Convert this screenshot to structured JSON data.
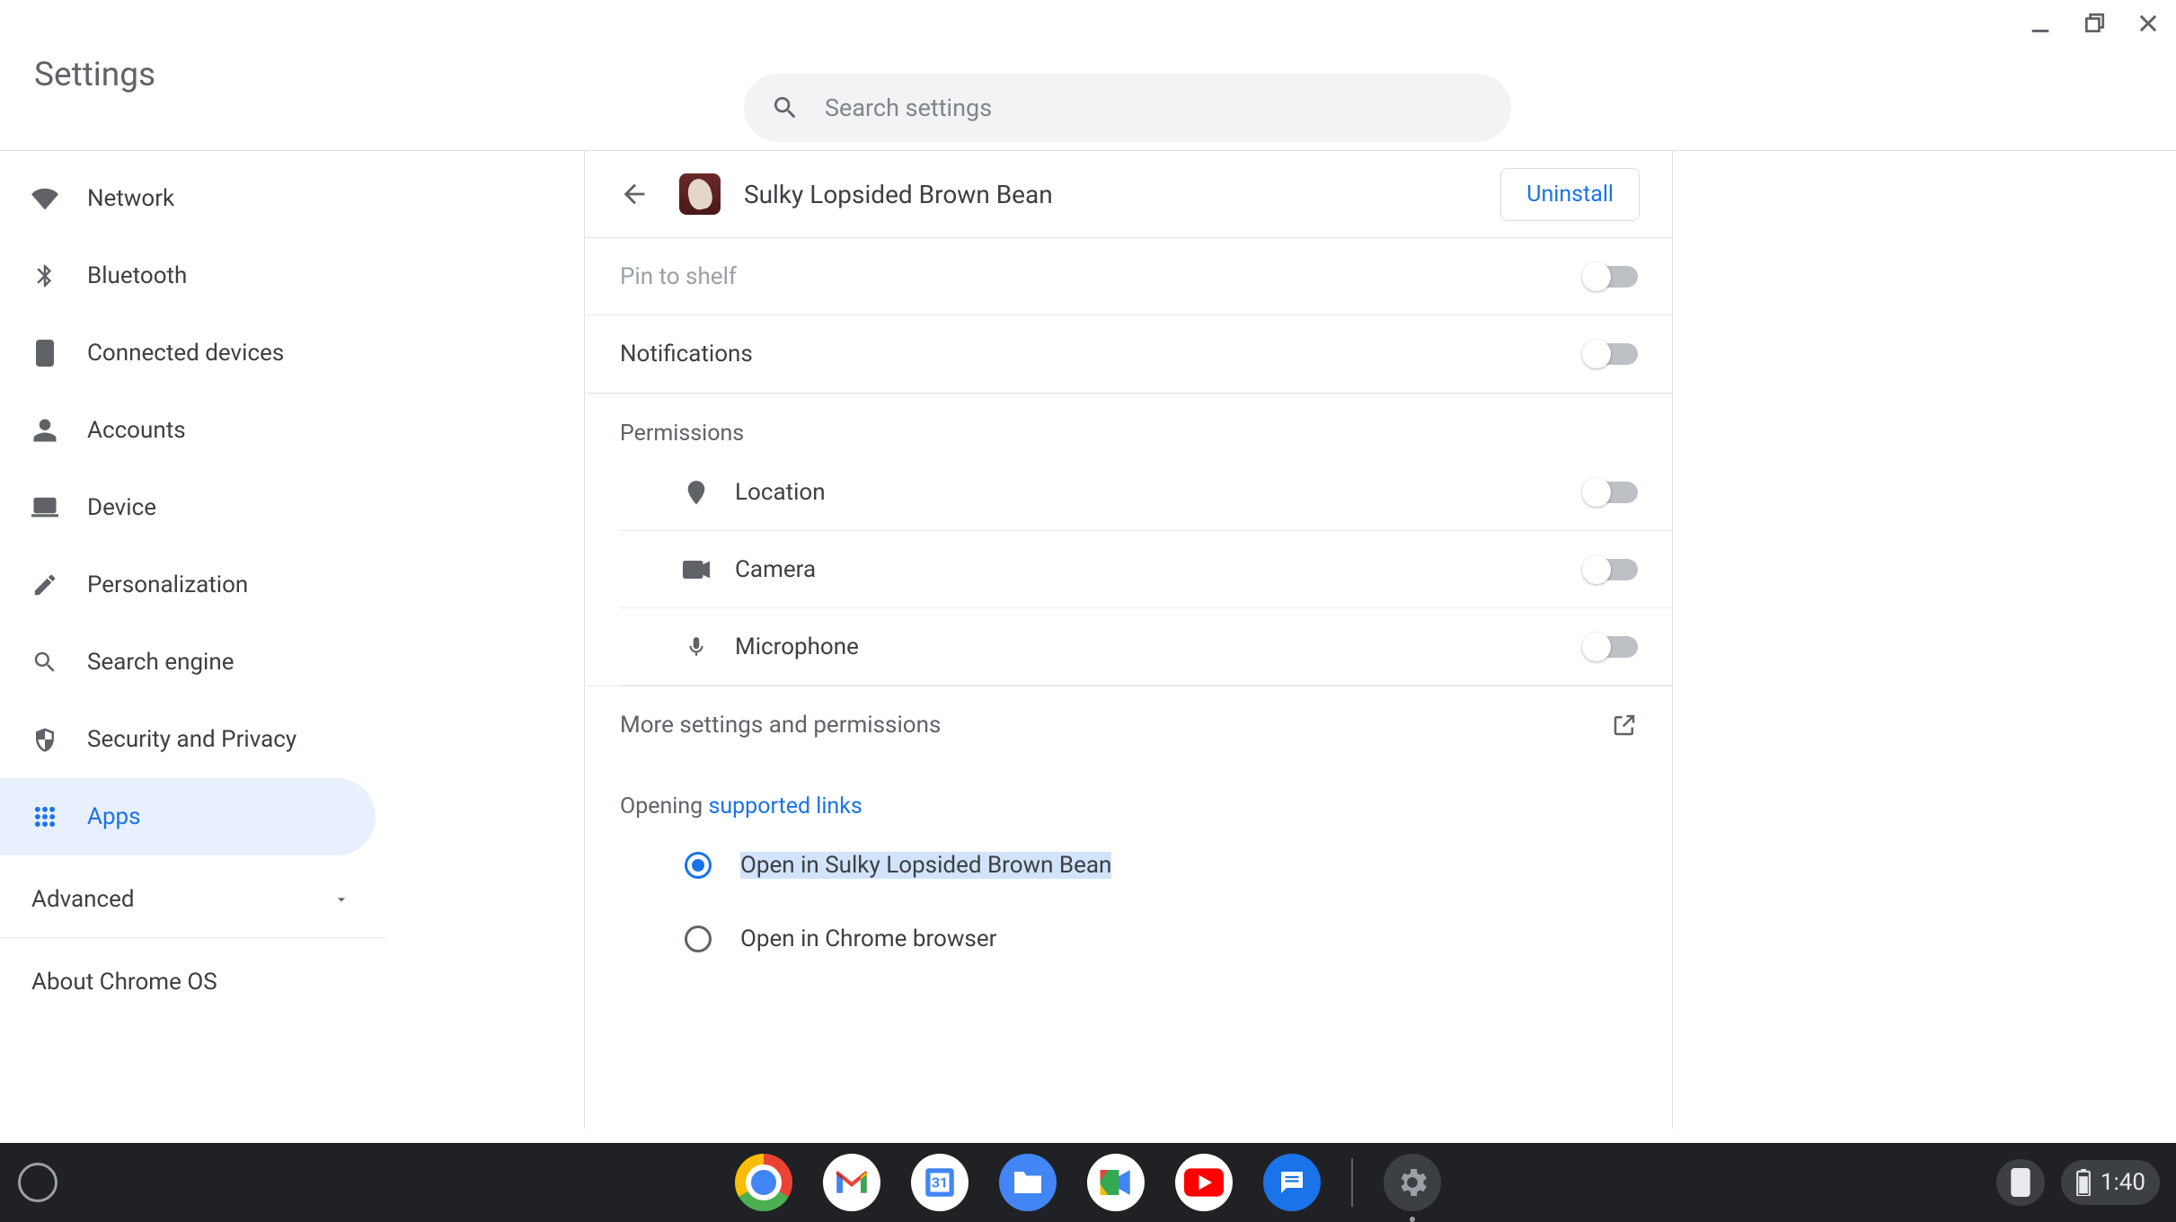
{
  "window_controls": {
    "minimize": "–",
    "maximize": "❐",
    "close": "✕"
  },
  "header": {
    "title": "Settings",
    "search_placeholder": "Search settings"
  },
  "sidebar": {
    "items": [
      {
        "id": "network",
        "label": "Network"
      },
      {
        "id": "bluetooth",
        "label": "Bluetooth"
      },
      {
        "id": "connected-devices",
        "label": "Connected devices"
      },
      {
        "id": "accounts",
        "label": "Accounts"
      },
      {
        "id": "device",
        "label": "Device"
      },
      {
        "id": "personalization",
        "label": "Personalization"
      },
      {
        "id": "search-engine",
        "label": "Search engine"
      },
      {
        "id": "security-privacy",
        "label": "Security and Privacy"
      },
      {
        "id": "apps",
        "label": "Apps",
        "selected": true
      }
    ],
    "advanced": "Advanced",
    "about": "About Chrome OS"
  },
  "app_detail": {
    "name": "Sulky Lopsided Brown Bean",
    "uninstall_label": "Uninstall",
    "pin_to_shelf": {
      "label": "Pin to shelf",
      "enabled": false
    },
    "notifications": {
      "label": "Notifications",
      "enabled": false
    },
    "permissions_header": "Permissions",
    "permissions": [
      {
        "id": "location",
        "label": "Location",
        "enabled": false
      },
      {
        "id": "camera",
        "label": "Camera",
        "enabled": false
      },
      {
        "id": "microphone",
        "label": "Microphone",
        "enabled": false
      }
    ],
    "more_settings": "More settings and permissions",
    "opening": {
      "prefix": "Opening ",
      "link": "supported links",
      "options": [
        {
          "label": "Open in Sulky Lopsided Brown Bean",
          "selected": true
        },
        {
          "label": "Open in Chrome browser",
          "selected": false
        }
      ]
    }
  },
  "shelf": {
    "apps": [
      {
        "id": "chrome",
        "name": "Chrome"
      },
      {
        "id": "gmail",
        "name": "Gmail"
      },
      {
        "id": "calendar",
        "name": "Calendar"
      },
      {
        "id": "files",
        "name": "Files"
      },
      {
        "id": "meet",
        "name": "Meet"
      },
      {
        "id": "youtube",
        "name": "YouTube"
      },
      {
        "id": "messages",
        "name": "Messages"
      }
    ],
    "active_app": {
      "id": "settings",
      "name": "Settings"
    },
    "clock": "1:40"
  }
}
